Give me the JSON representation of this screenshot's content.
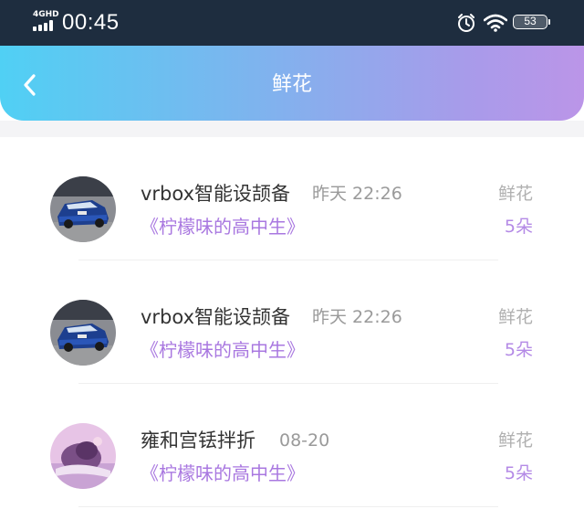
{
  "status_bar": {
    "network": "4GHD",
    "time": "00:45",
    "battery": "53"
  },
  "header": {
    "title": "鲜花"
  },
  "records": [
    {
      "user": "vrbox智能设颉备",
      "time": "昨天 22:26",
      "target": "《柠檬味的高中生》",
      "gift": "鲜花",
      "count": "5朵"
    },
    {
      "user": "vrbox智能设颉备",
      "time": "昨天 22:26",
      "target": "《柠檬味的高中生》",
      "gift": "鲜花",
      "count": "5朵"
    },
    {
      "user": "雍和宫铥拌折",
      "time": "08-20",
      "target": "《柠檬味的高中生》",
      "gift": "鲜花",
      "count": "5朵"
    }
  ],
  "colors": {
    "header_gradient_start": "#50d0f4",
    "header_gradient_end": "#bb95e8",
    "accent_purple": "#a978e0",
    "status_bar": "#1e2d3f"
  },
  "icons": {
    "back": "chevron-left-icon",
    "alarm": "alarm-clock-icon",
    "wifi": "wifi-icon",
    "signal": "signal-bars-icon"
  }
}
